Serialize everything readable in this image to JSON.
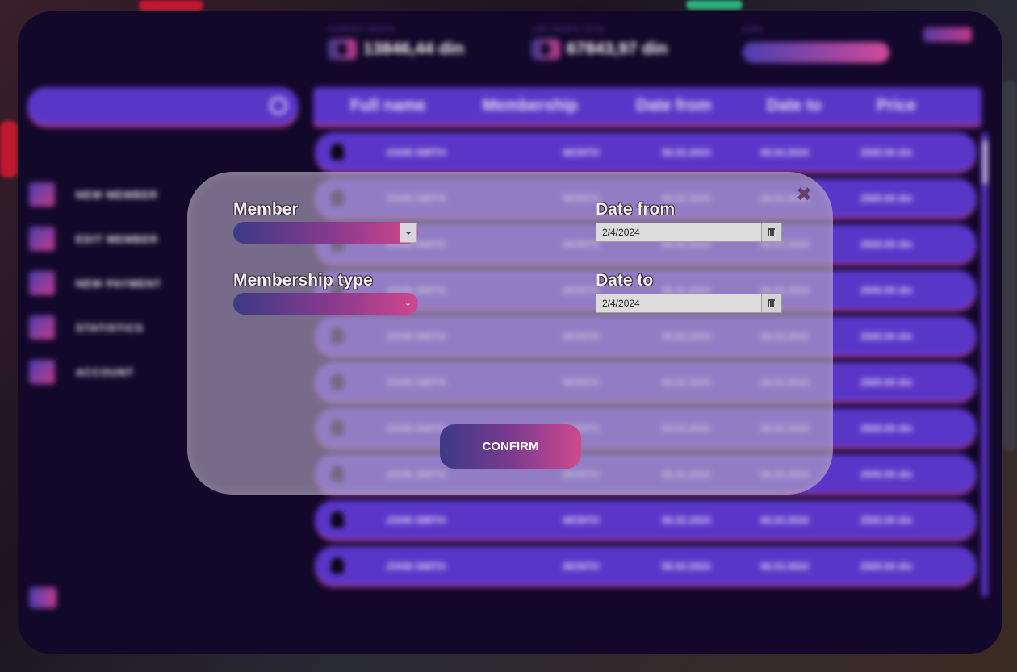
{
  "header": {
    "stats": [
      {
        "label": "CURRENT MONTH",
        "value": "13846,44 din"
      },
      {
        "label": "LAST MONTH TOTAL",
        "value": "67843,97 din"
      },
      {
        "label": "GOAL",
        "value": ""
      }
    ]
  },
  "search": {
    "placeholder": ""
  },
  "sidebar": {
    "items": [
      {
        "label": "NEW MEMBER"
      },
      {
        "label": "EDIT MEMBER"
      },
      {
        "label": "NEW PAYMENT"
      },
      {
        "label": "STATISTICS"
      },
      {
        "label": "ACCOUNT"
      }
    ]
  },
  "table": {
    "columns": [
      "Full name",
      "Membership",
      "Date from",
      "Date to",
      "Price"
    ],
    "rows": [
      {
        "name": "JOHN SMITH",
        "membership": "MONTH",
        "from": "06.02.2024",
        "to": "06.03.2024",
        "price": "2500.00 din"
      },
      {
        "name": "JOHN SMITH",
        "membership": "MONTH",
        "from": "06.02.2024",
        "to": "06.03.2024",
        "price": "2500.00 din"
      },
      {
        "name": "JOHN SMITH",
        "membership": "MONTH",
        "from": "06.02.2024",
        "to": "06.03.2024",
        "price": "2500.00 din"
      },
      {
        "name": "JOHN SMITH",
        "membership": "MONTH",
        "from": "06.02.2024",
        "to": "06.03.2024",
        "price": "2500.00 din"
      },
      {
        "name": "JOHN SMITH",
        "membership": "MONTH",
        "from": "06.02.2024",
        "to": "06.03.2024",
        "price": "2500.00 din"
      },
      {
        "name": "JOHN SMITH",
        "membership": "MONTH",
        "from": "06.02.2024",
        "to": "06.03.2024",
        "price": "2500.00 din"
      },
      {
        "name": "JOHN SMITH",
        "membership": "MONTH",
        "from": "06.02.2024",
        "to": "06.03.2024",
        "price": "2500.00 din"
      },
      {
        "name": "JOHN SMITH",
        "membership": "MONTH",
        "from": "06.02.2024",
        "to": "06.03.2024",
        "price": "2500.00 din"
      },
      {
        "name": "JOHN SMITH",
        "membership": "MONTH",
        "from": "06.02.2024",
        "to": "06.03.2024",
        "price": "2500.00 din"
      },
      {
        "name": "JOHN SMITH",
        "membership": "MONTH",
        "from": "06.02.2024",
        "to": "06.03.2024",
        "price": "2500.00 din"
      }
    ]
  },
  "modal": {
    "member_label": "Member",
    "member_value": "",
    "membership_type_label": "Membership type",
    "membership_type_value": "",
    "date_from_label": "Date from",
    "date_from_value": "2/4/2024",
    "date_to_label": "Date to",
    "date_to_value": "2/4/2024",
    "confirm_label": "CONFIRM",
    "close_glyph": "✖"
  },
  "colors": {
    "app_bg": "#12082a",
    "accent_purple": "#5a36c8",
    "accent_pink": "#b53a8f",
    "gradient_start": "#3b3a85",
    "gradient_end": "#d1468e"
  },
  "icons": [
    "search-icon",
    "new-member-icon",
    "edit-member-icon",
    "new-payment-icon",
    "statistics-icon",
    "account-icon",
    "logout-icon",
    "avatar-icon",
    "close-icon",
    "calendar-icon",
    "chevron-down-icon"
  ]
}
